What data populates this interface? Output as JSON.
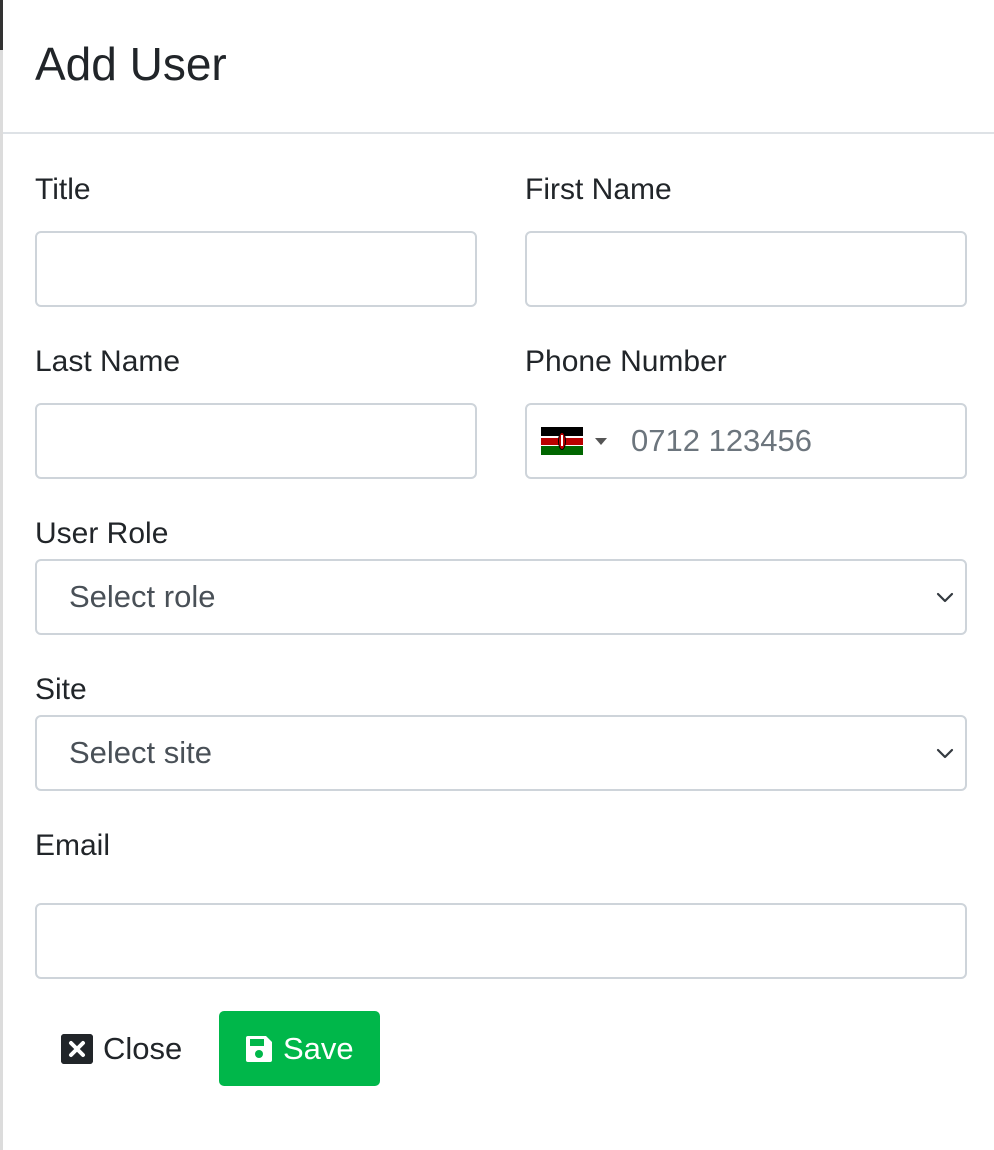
{
  "modal": {
    "title": "Add User"
  },
  "form": {
    "title_label": "Title",
    "first_name_label": "First Name",
    "last_name_label": "Last Name",
    "phone_label": "Phone Number",
    "phone_placeholder": "0712 123456",
    "phone_country": "Kenya",
    "role_label": "User Role",
    "role_selected": "Select role",
    "site_label": "Site",
    "site_selected": "Select site",
    "email_label": "Email"
  },
  "actions": {
    "close_label": "Close",
    "save_label": "Save",
    "close_icon": "close-square-icon",
    "save_icon": "floppy-disk-icon"
  },
  "colors": {
    "save_button": "#00b74a",
    "border": "#ced4da"
  }
}
